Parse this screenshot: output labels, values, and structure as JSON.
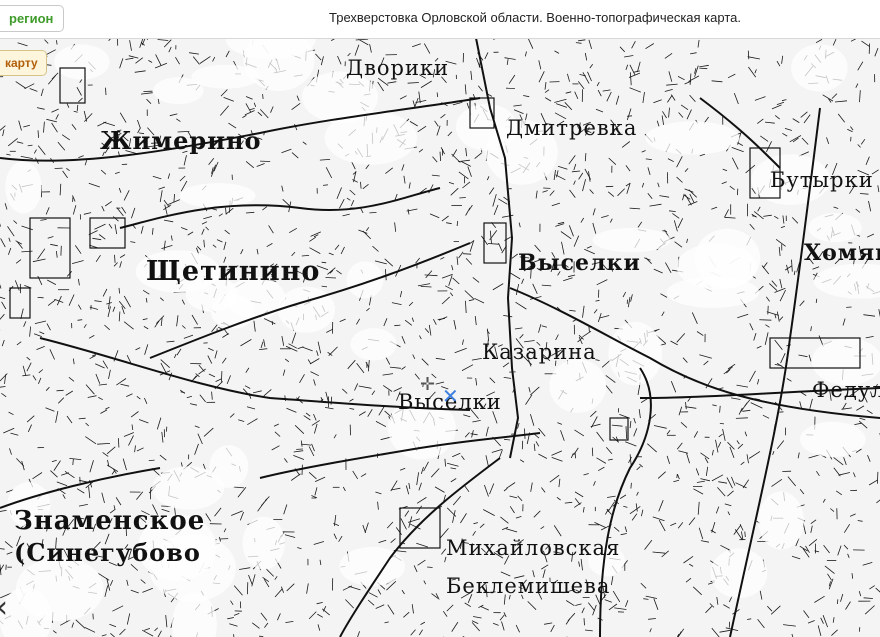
{
  "header": {
    "region_button": "регион",
    "title": "Трехверстовка Орловской области. Военно-топографическая карта."
  },
  "map": {
    "back_button": "карту",
    "labels": {
      "dvoriki": "Дворики",
      "dmitrievka": "Дмитревка",
      "zhimerino": "Жимерино",
      "shchetinino": "Щетинино",
      "vyselki_1": "Выселки",
      "butyrki": "Бутырки",
      "khomyak": "Хомяк",
      "kazarina": "Казарина",
      "vyselki_2": "Выселки",
      "fedul": "Федул",
      "znamenskoe": "Знаменское",
      "sinegubovo": "(Синегубово",
      "mikhailovskaya": "Михайловская",
      "beklemisheva": "Беклемишева"
    },
    "nav_arrow": "‹",
    "crosshair": "✛",
    "marker": "✕",
    "colors": {
      "ink": "#111111",
      "paper": "#f4f4f4",
      "region_text": "#3f9c2a",
      "back_text": "#b25f0a",
      "marker": "#3d7fe0"
    }
  }
}
